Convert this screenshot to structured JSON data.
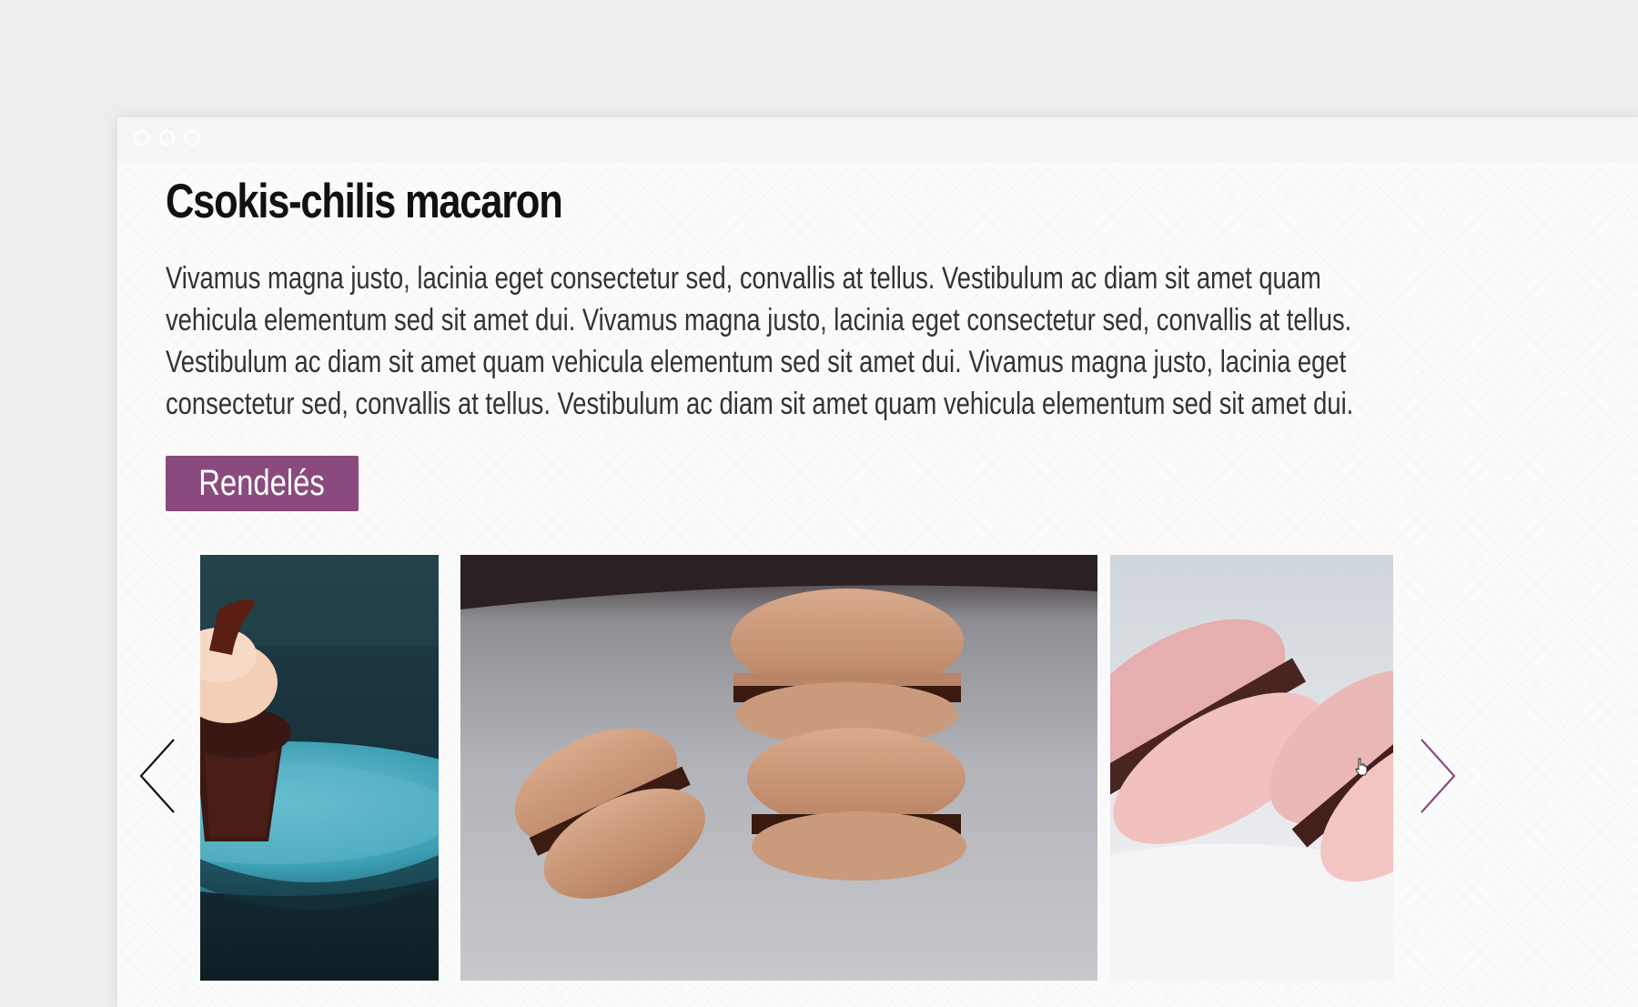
{
  "product": {
    "title": "Csokis-chilis macaron",
    "description": "Vivamus magna justo, lacinia eget consectetur sed, convallis at tellus. Vestibulum ac diam sit amet quam vehicula elementum sed sit amet dui. Vivamus magna justo, lacinia eget consectetur sed, convallis at tellus. Vestibulum ac diam sit amet quam vehicula elementum sed sit amet dui. Vivamus magna justo, lacinia eget consectetur sed, convallis at tellus. Vestibulum ac diam sit amet quam vehicula elementum sed sit amet dui.",
    "order_button": "Rendelés"
  },
  "gallery": {
    "images": [
      {
        "subject": "chocolate cupcake on turquoise plate"
      },
      {
        "subject": "stacked chocolate macarons"
      },
      {
        "subject": "pink macarons with chocolate filling"
      }
    ],
    "prev_icon": "chevron-left-icon",
    "next_icon": "chevron-right-icon"
  },
  "colors": {
    "accent": "#8a4a7e",
    "background": "#eeeeee"
  }
}
